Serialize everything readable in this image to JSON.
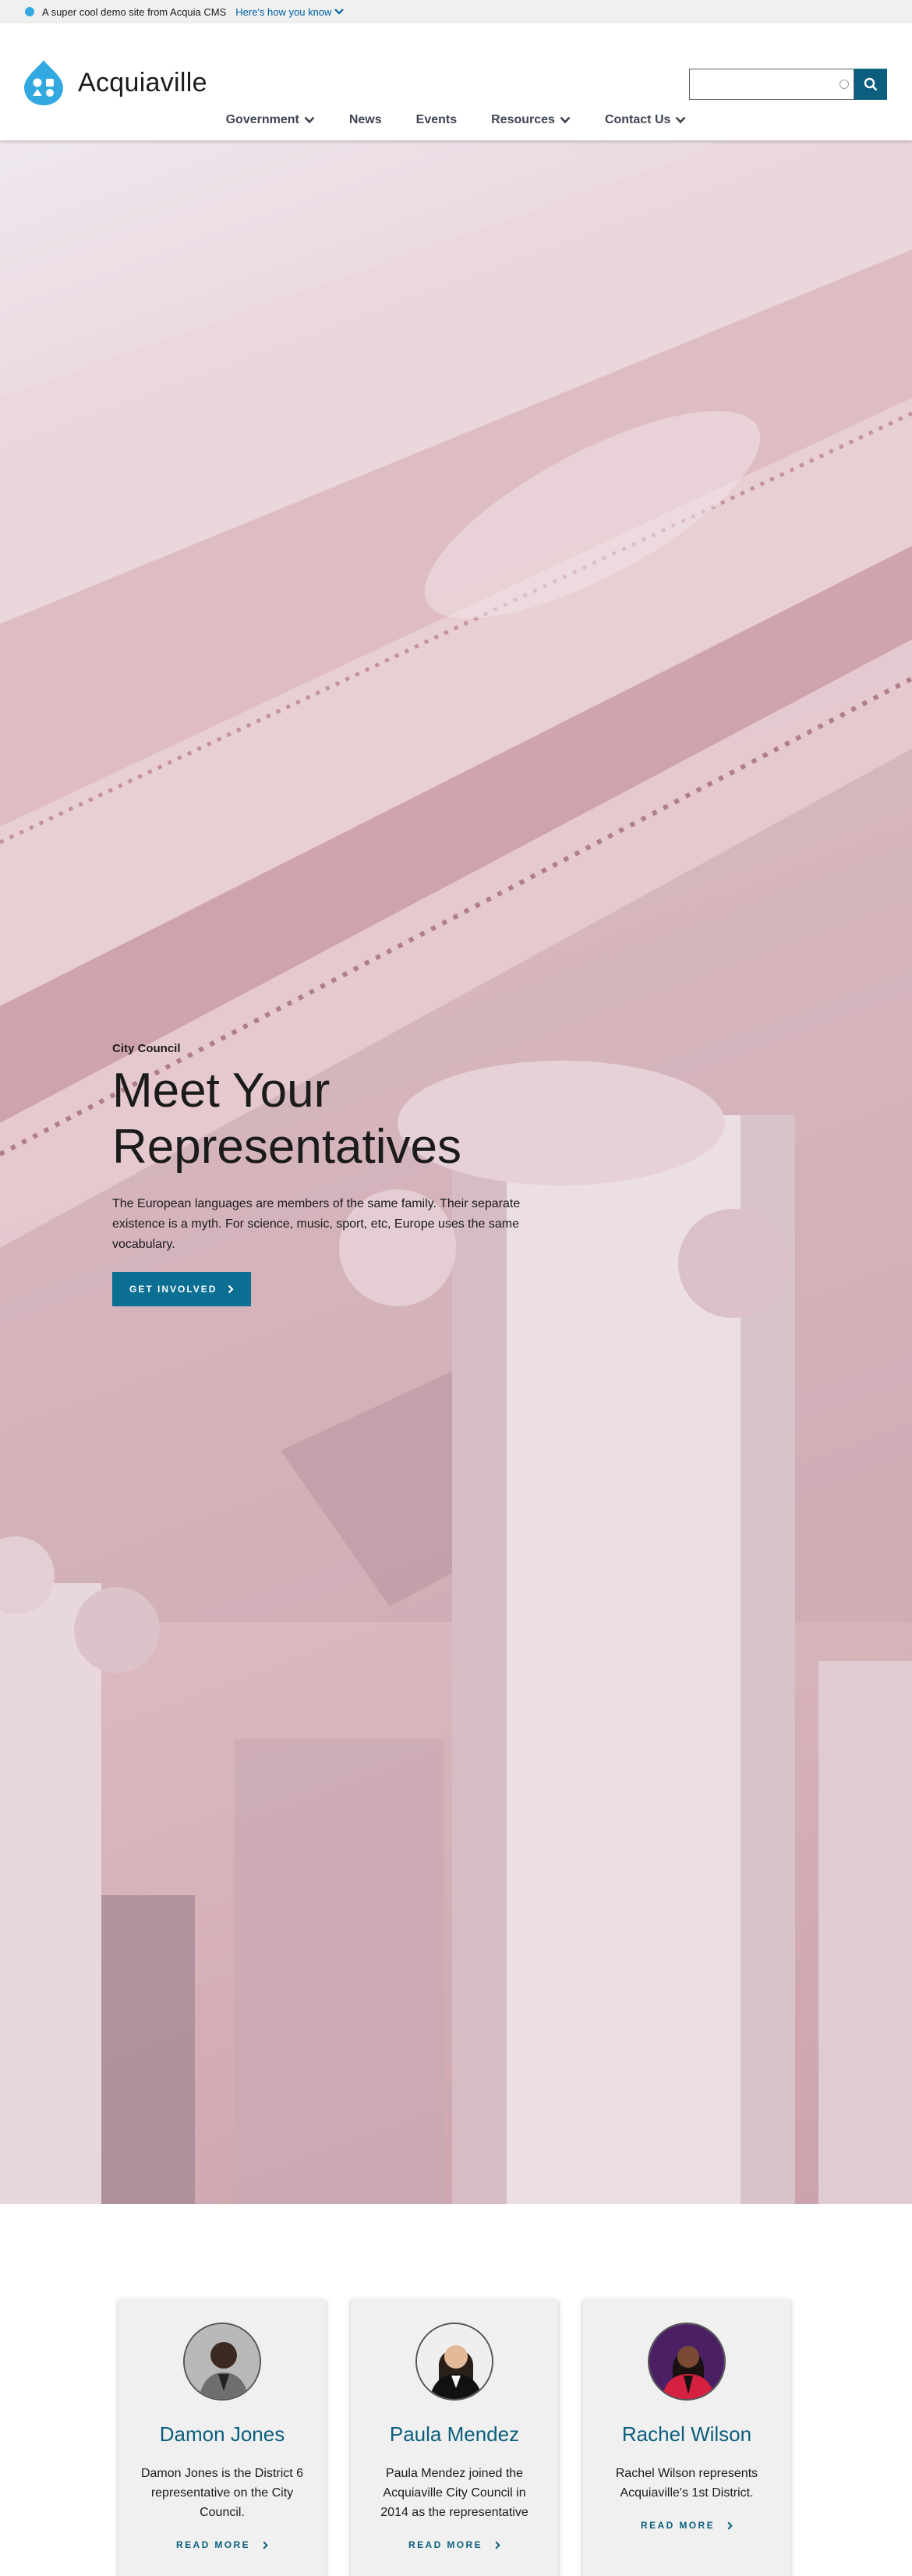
{
  "banner": {
    "text": "A super cool demo site from Acquia CMS",
    "link": "Here's how you know"
  },
  "site": {
    "name": "Acquiaville",
    "brand_color": "#31a9e0"
  },
  "search": {
    "placeholder": ""
  },
  "nav": {
    "items": [
      {
        "label": "Government",
        "has_dropdown": true
      },
      {
        "label": "News",
        "has_dropdown": false
      },
      {
        "label": "Events",
        "has_dropdown": false
      },
      {
        "label": "Resources",
        "has_dropdown": true
      },
      {
        "label": "Contact Us",
        "has_dropdown": true
      }
    ]
  },
  "hero": {
    "eyebrow": "City Council",
    "title": "Meet Your Representatives",
    "description": "The European languages are members of the same family. Their separate existence is a myth. For science, music, sport, etc, Europe uses the same vocabulary.",
    "cta": "GET INVOLVED"
  },
  "cards": [
    {
      "name": "Damon Jones",
      "description": "Damon Jones is the District 6 representative on the City Council.",
      "link": "READ MORE"
    },
    {
      "name": "Paula Mendez",
      "description": "Paula Mendez joined the Acquiaville City Council in 2014 as the representative",
      "link": "READ MORE"
    },
    {
      "name": "Rachel Wilson",
      "description": "Rachel Wilson represents Acquiaville's 1st District.",
      "link": "READ MORE"
    }
  ],
  "colors": {
    "accent": "#0b6e93",
    "link": "#005ea2",
    "heading": "#0b5e7d"
  }
}
